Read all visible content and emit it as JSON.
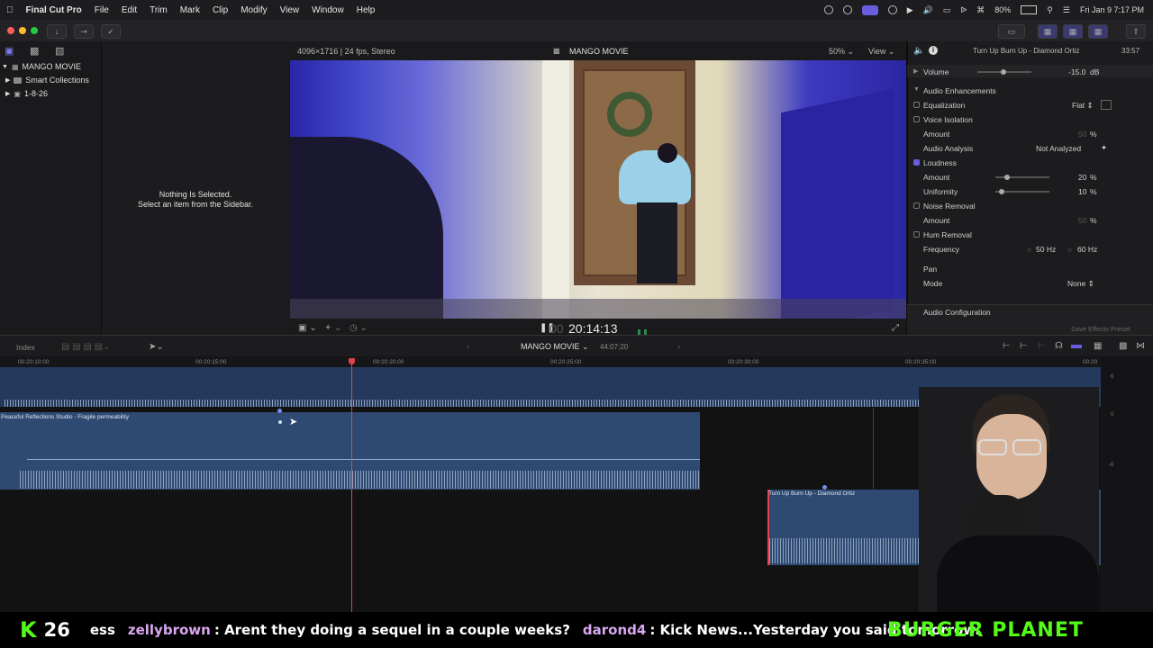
{
  "menubar": {
    "app_name": "Final Cut Pro",
    "menus": [
      "File",
      "Edit",
      "Trim",
      "Mark",
      "Clip",
      "Modify",
      "View",
      "Window",
      "Help"
    ],
    "battery": "80%",
    "clock": "Fri Jan 9  7:17 PM"
  },
  "sidebar": {
    "library": "MANGO MOVIE",
    "items": [
      {
        "label": "Smart Collections"
      },
      {
        "label": "1-8-26"
      }
    ]
  },
  "browser": {
    "empty_title": "Nothing Is Selected.",
    "empty_hint": "Select an item from the Sidebar."
  },
  "viewer": {
    "format": "4096×1716 | 24 fps, Stereo",
    "title": "MANGO MOVIE",
    "zoom": "50%",
    "view_label": "View",
    "timecode": "20:14:13"
  },
  "inspector": {
    "clip_title": "Turn Up Burn Up - Diamond Ortiz",
    "duration": "33:57",
    "volume_label": "Volume",
    "volume_value": "-15.0",
    "volume_unit": "dB",
    "enhancements_label": "Audio Enhancements",
    "equalization_label": "Equalization",
    "equalization_value": "Flat",
    "voice_isolation_label": "Voice Isolation",
    "amount_label": "Amount",
    "vi_amount": "50",
    "percent": "%",
    "analysis_label": "Audio Analysis",
    "analysis_value": "Not Analyzed",
    "loudness_label": "Loudness",
    "loudness_amount": "20",
    "uniformity_label": "Uniformity",
    "uniformity_value": "10",
    "noise_label": "Noise Removal",
    "noise_amount": "50",
    "hum_label": "Hum Removal",
    "frequency_label": "Frequency",
    "freq_50": "50",
    "freq_60": "60",
    "hz": "Hz",
    "pan_label": "Pan",
    "mode_label": "Mode",
    "mode_value": "None",
    "audio_config_label": "Audio Configuration",
    "save_preset": "Save Effects Preset"
  },
  "timeline": {
    "index_label": "Index",
    "project_name": "MANGO MOVIE",
    "duration": "44:07:20",
    "ruler": [
      "00:20:10:00",
      "00:20:15:00",
      "00:20:20:00",
      "00:20:25:00",
      "00:20:30:00",
      "00:20:35:00",
      "00:20"
    ],
    "clip_a": "Peaceful Reflections Studio - Fragile permeability",
    "clip_b": "Turn Up Burn Up - Diamond Ortiz",
    "meter_labels": [
      "6",
      "0",
      "-6"
    ]
  },
  "ticker": {
    "k_letter": "K",
    "k_count": "26",
    "lead_text": "ess",
    "msgs": [
      {
        "user": "zellybrown",
        "text": ": Arent they doing a sequel in a couple weeks?"
      },
      {
        "user": "darond4",
        "text": ": Kick News...Yesterday you said tomorrow."
      }
    ],
    "brand": "BURGER PLANET"
  },
  "colors": {
    "accent": "#6a5de0",
    "playhead": "#e0434b",
    "clip": "#2e4a72",
    "kick_green": "#53fc18"
  }
}
